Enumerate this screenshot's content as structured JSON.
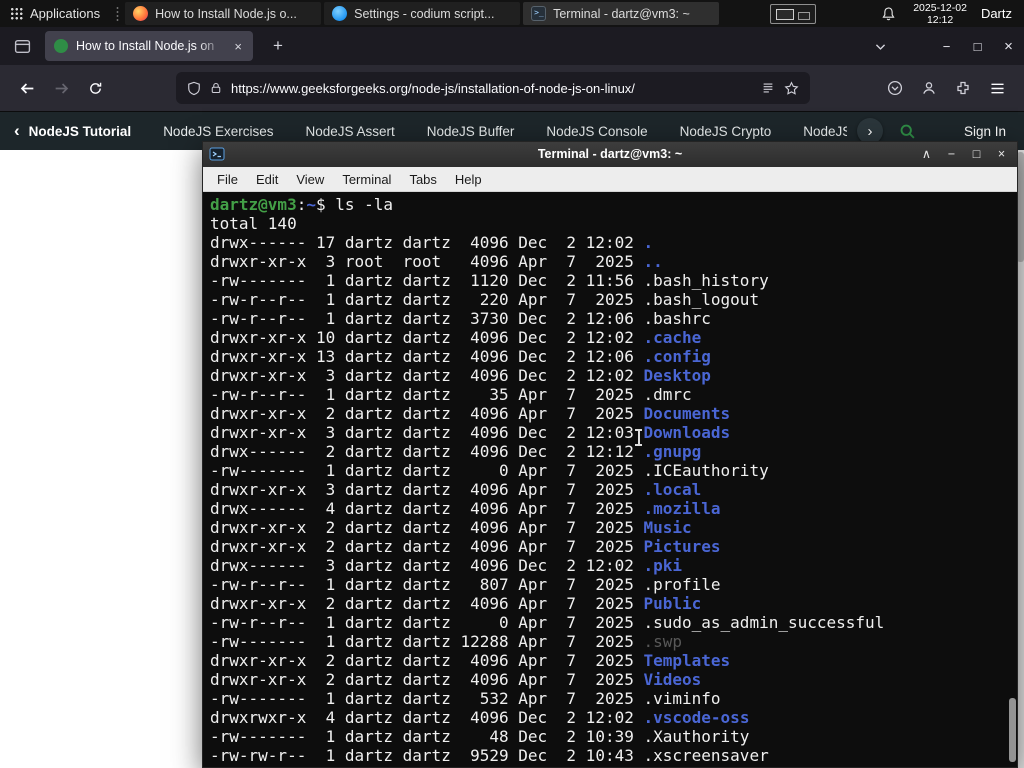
{
  "panel": {
    "applications_label": "Applications",
    "tasks": [
      {
        "title": "How to Install Node.js o..."
      },
      {
        "title": "Settings - codium script..."
      },
      {
        "title": "Terminal - dartz@vm3: ~"
      }
    ],
    "date": "2025-12-02",
    "time": "12:12",
    "user": "Dartz"
  },
  "browser": {
    "tab_title": "How to Install Node.js on",
    "url": "https://www.geeksforgeeks.org/node-js/installation-of-node-js-on-linux/"
  },
  "site_nav": {
    "primary": "NodeJS Tutorial",
    "items": [
      "NodeJS Exercises",
      "NodeJS Assert",
      "NodeJS Buffer",
      "NodeJS Console",
      "NodeJS Crypto",
      "NodeJS DNS",
      "Node"
    ],
    "sign_in": "Sign In"
  },
  "terminal": {
    "title": "Terminal - dartz@vm3: ~",
    "menu": [
      "File",
      "Edit",
      "View",
      "Terminal",
      "Tabs",
      "Help"
    ],
    "lines": [
      [
        [
          "g",
          "dartz@vm3"
        ],
        [
          "w",
          ":"
        ],
        [
          "b",
          "~"
        ],
        [
          "w",
          "$ ls -la"
        ]
      ],
      [
        [
          "w",
          "total 140"
        ]
      ],
      [
        [
          "w",
          "drwx------ 17 dartz dartz  4096 Dec  2 12:02 "
        ],
        [
          "b",
          "."
        ]
      ],
      [
        [
          "w",
          "drwxr-xr-x  3 root  root   4096 Apr  7  2025 "
        ],
        [
          "b",
          ".."
        ]
      ],
      [
        [
          "w",
          "-rw-------  1 dartz dartz  1120 Dec  2 11:56 .bash_history"
        ]
      ],
      [
        [
          "w",
          "-rw-r--r--  1 dartz dartz   220 Apr  7  2025 .bash_logout"
        ]
      ],
      [
        [
          "w",
          "-rw-r--r--  1 dartz dartz  3730 Dec  2 12:06 .bashrc"
        ]
      ],
      [
        [
          "w",
          "drwxr-xr-x 10 dartz dartz  4096 Dec  2 12:02 "
        ],
        [
          "b",
          ".cache"
        ]
      ],
      [
        [
          "w",
          "drwxr-xr-x 13 dartz dartz  4096 Dec  2 12:06 "
        ],
        [
          "b",
          ".config"
        ]
      ],
      [
        [
          "w",
          "drwxr-xr-x  3 dartz dartz  4096 Dec  2 12:02 "
        ],
        [
          "b",
          "Desktop"
        ]
      ],
      [
        [
          "w",
          "-rw-r--r--  1 dartz dartz    35 Apr  7  2025 .dmrc"
        ]
      ],
      [
        [
          "w",
          "drwxr-xr-x  2 dartz dartz  4096 Apr  7  2025 "
        ],
        [
          "b",
          "Documents"
        ]
      ],
      [
        [
          "w",
          "drwxr-xr-x  3 dartz dartz  4096 Dec  2 12:03 "
        ],
        [
          "b",
          "Downloads"
        ]
      ],
      [
        [
          "w",
          "drwx------  2 dartz dartz  4096 Dec  2 12:12 "
        ],
        [
          "b",
          ".gnupg"
        ]
      ],
      [
        [
          "w",
          "-rw-------  1 dartz dartz     0 Apr  7  2025 .ICEauthority"
        ]
      ],
      [
        [
          "w",
          "drwxr-xr-x  3 dartz dartz  4096 Apr  7  2025 "
        ],
        [
          "b",
          ".local"
        ]
      ],
      [
        [
          "w",
          "drwx------  4 dartz dartz  4096 Apr  7  2025 "
        ],
        [
          "b",
          ".mozilla"
        ]
      ],
      [
        [
          "w",
          "drwxr-xr-x  2 dartz dartz  4096 Apr  7  2025 "
        ],
        [
          "b",
          "Music"
        ]
      ],
      [
        [
          "w",
          "drwxr-xr-x  2 dartz dartz  4096 Apr  7  2025 "
        ],
        [
          "b",
          "Pictures"
        ]
      ],
      [
        [
          "w",
          "drwx------  3 dartz dartz  4096 Dec  2 12:02 "
        ],
        [
          "b",
          ".pki"
        ]
      ],
      [
        [
          "w",
          "-rw-r--r--  1 dartz dartz   807 Apr  7  2025 .profile"
        ]
      ],
      [
        [
          "w",
          "drwxr-xr-x  2 dartz dartz  4096 Apr  7  2025 "
        ],
        [
          "b",
          "Public"
        ]
      ],
      [
        [
          "w",
          "-rw-r--r--  1 dartz dartz     0 Apr  7  2025 .sudo_as_admin_successful"
        ]
      ],
      [
        [
          "w",
          "-rw-------  1 dartz dartz 12288 Apr  7  2025 "
        ],
        [
          "dim",
          ".swp"
        ]
      ],
      [
        [
          "w",
          "drwxr-xr-x  2 dartz dartz  4096 Apr  7  2025 "
        ],
        [
          "b",
          "Templates"
        ]
      ],
      [
        [
          "w",
          "drwxr-xr-x  2 dartz dartz  4096 Apr  7  2025 "
        ],
        [
          "b",
          "Videos"
        ]
      ],
      [
        [
          "w",
          "-rw-------  1 dartz dartz   532 Apr  7  2025 .viminfo"
        ]
      ],
      [
        [
          "w",
          "drwxrwxr-x  4 dartz dartz  4096 Dec  2 12:02 "
        ],
        [
          "b",
          ".vscode-oss"
        ]
      ],
      [
        [
          "w",
          "-rw-------  1 dartz dartz    48 Dec  2 10:39 .Xauthority"
        ]
      ],
      [
        [
          "w",
          "-rw-rw-r--  1 dartz dartz  9529 Dec  2 10:43 .xscreensaver"
        ]
      ]
    ]
  },
  "glyphs": {
    "plus": "+",
    "close": "×",
    "minimize": "−",
    "maximize": "□",
    "shade": "∧",
    "chevron_left": "‹",
    "chevron_right": "›",
    "tab_close": "×"
  },
  "colors": {
    "gfg_green": "#2f8d46",
    "terminal_dir_blue": "#4a66d4",
    "terminal_prompt_green": "#43a047",
    "terminal_background": "#0d0d0d",
    "panel_background": "#131313"
  }
}
